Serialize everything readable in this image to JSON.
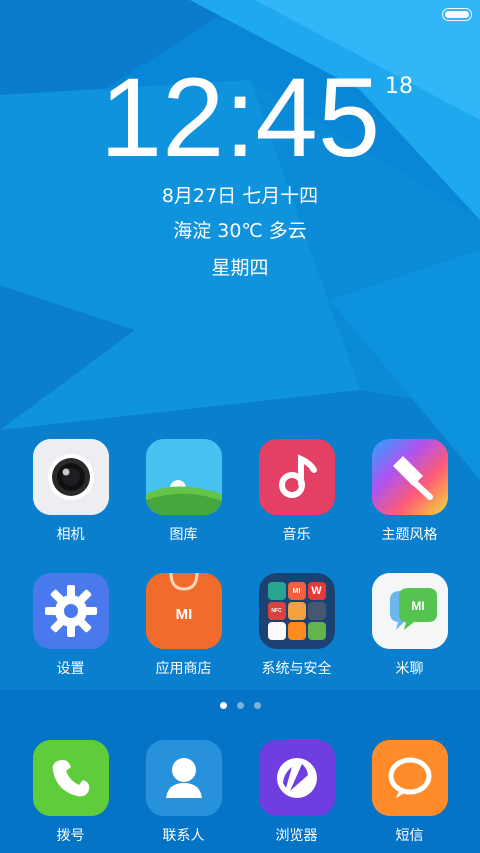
{
  "status_bar": {
    "battery_level": 1
  },
  "lock_clock": {
    "time": "12:45",
    "seconds": "18",
    "date": "8月27日 七月十四",
    "weather": "海淀 30℃ 多云",
    "weekday": "星期四"
  },
  "apps": [
    {
      "label": "相机",
      "icon": "camera-icon"
    },
    {
      "label": "图库",
      "icon": "gallery-icon"
    },
    {
      "label": "音乐",
      "icon": "music-icon"
    },
    {
      "label": "主题风格",
      "icon": "theme-brush-icon"
    },
    {
      "label": "设置",
      "icon": "gear-icon"
    },
    {
      "label": "应用商店",
      "icon": "app-store-bag-icon"
    },
    {
      "label": "系统与安全",
      "icon": "system-security-folder-icon"
    },
    {
      "label": "米聊",
      "icon": "mi-chat-icon"
    }
  ],
  "page_indicator": {
    "count": 3,
    "active_index": 0
  },
  "dock": [
    {
      "label": "拨号",
      "icon": "phone-icon"
    },
    {
      "label": "联系人",
      "icon": "contacts-icon"
    },
    {
      "label": "浏览器",
      "icon": "browser-icon"
    },
    {
      "label": "短信",
      "icon": "message-icon"
    }
  ],
  "colors": {
    "wallpaper_primary": "#0a86d6",
    "wallpaper_dark": "#065eb4",
    "wallpaper_light": "#2fa5f1"
  },
  "icon_text": {
    "mi": "MI",
    "wps": "W",
    "nfc": "NFC"
  }
}
